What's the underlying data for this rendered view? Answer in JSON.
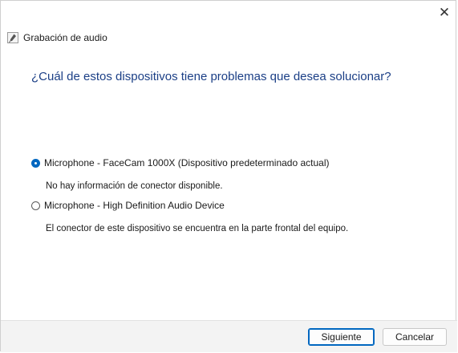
{
  "window": {
    "close_glyph": "✕"
  },
  "wizard": {
    "title": "Grabación de audio",
    "icon": "microphone-wizard-icon"
  },
  "question": "¿Cuál de estos dispositivos tiene problemas que desea solucionar?",
  "options": [
    {
      "label": "Microphone - FaceCam 1000X (Dispositivo predeterminado actual)",
      "description": "No hay información de conector disponible.",
      "checked": true
    },
    {
      "label": "Microphone - High Definition Audio Device",
      "description": "El conector de este dispositivo se encuentra en la parte frontal del equipo.",
      "checked": false
    }
  ],
  "buttons": {
    "next": "Siguiente",
    "cancel": "Cancelar"
  },
  "colors": {
    "accent": "#0067c0",
    "heading": "#1b3f86",
    "footer_bg": "#f3f3f3"
  }
}
